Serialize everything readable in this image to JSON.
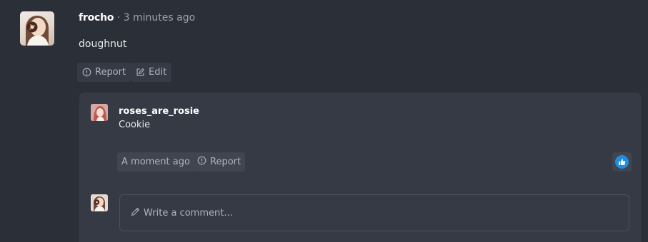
{
  "comment": {
    "author": "frocho",
    "separator": "·",
    "timestamp": "3 minutes ago",
    "text": "doughnut",
    "report_label": "Report",
    "edit_label": "Edit"
  },
  "reply": {
    "author": "roses_are_rosie",
    "text": "Cookie",
    "timestamp": "A moment ago",
    "report_label": "Report",
    "like_icon": "thumbs-up-icon",
    "like_color": "#1f8ee0"
  },
  "composer": {
    "placeholder": "Write a comment..."
  },
  "icons": {
    "report": "alert-circle-icon",
    "edit": "edit-icon",
    "pencil": "pencil-icon"
  }
}
